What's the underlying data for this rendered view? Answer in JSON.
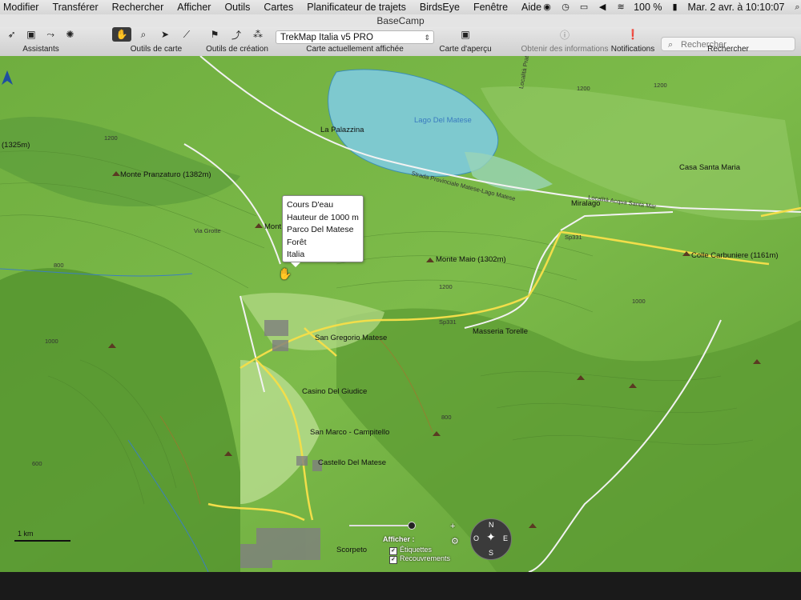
{
  "menubar": {
    "items": [
      "Modifier",
      "Transférer",
      "Rechercher",
      "Afficher",
      "Outils",
      "Cartes",
      "Planificateur de trajets",
      "BirdsEye",
      "Fenêtre",
      "Aide"
    ],
    "battery": "100 %",
    "datetime": "Mar. 2 avr. à  10:10:07"
  },
  "window": {
    "title": "BaseCamp"
  },
  "toolbar": {
    "assistants_label": "Assistants",
    "map_tools_label": "Outils de carte",
    "create_tools_label": "Outils de création",
    "current_map_label": "Carte actuellement affichée",
    "current_map_value": "TrekMap Italia v5 PRO",
    "overview_label": "Carte d'aperçu",
    "info_label": "Obtenir des informations",
    "notifications_label": "Notifications",
    "search_label": "Rechercher",
    "search_placeholder": "Rechercher"
  },
  "map": {
    "labels": {
      "lake": "Lago Del Matese",
      "palazzina": "La Palazzina",
      "pranzaturo": "Monte Pranzaturo (1382m)",
      "left_peak": "(1325m)",
      "casa_santa_maria": "Casa Santa Maria",
      "miralago": "Miralago",
      "sp331_a": "Sp331",
      "sp331_b": "Sp331",
      "colle": "Colle Carbuniere (1161m)",
      "monte_maio": "Monte Maio (1302m)",
      "masseria": "Masseria Torelle",
      "san_gregorio": "San Gregorio Matese",
      "casino": "Casino Del Giudice",
      "san_marco": "San Marco - Campitello",
      "castello": "Castello Del Matese",
      "scorpeto": "Scorpeto",
      "via_grotte": "Via Grotte",
      "strada": "Strada Provinciale Matese-Lago Matese",
      "localita": "Località Acqua Santa Mar",
      "localita_prati": "Località Prati",
      "monte_partial": "Mont",
      "c1200a": "1200",
      "c1200b": "1200",
      "c1200c": "1200",
      "c1200d": "1200",
      "c1000a": "1000",
      "c1000b": "1000",
      "c800a": "800",
      "c800b": "800",
      "c600": "600"
    },
    "popup": [
      "Cours D'eau",
      "Hauteur de 1000 m",
      "Parco Del Matese",
      "Forêt",
      "Italia"
    ],
    "scale": "1 km",
    "overlay": {
      "afficher": "Afficher :",
      "etiquettes": "Étiquettes",
      "recouvrements": "Recouvrements"
    },
    "compass": {
      "n": "N",
      "s": "S",
      "e": "E",
      "o": "O"
    }
  }
}
